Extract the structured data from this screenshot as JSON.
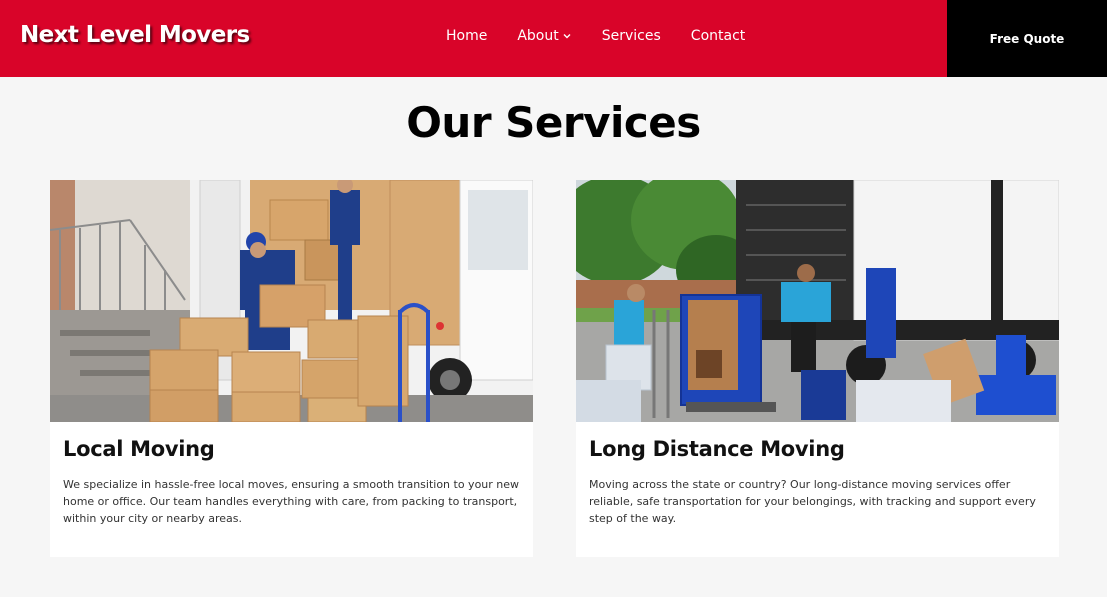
{
  "header": {
    "brand": "Next Level Movers",
    "nav": [
      {
        "label": "Home"
      },
      {
        "label": "About"
      },
      {
        "label": "Services"
      },
      {
        "label": "Contact"
      }
    ],
    "cta": "Free Quote",
    "colors": {
      "header_bg": "#d90429",
      "cta_bg": "#000000"
    }
  },
  "main": {
    "title": "Our Services",
    "cards": [
      {
        "title": "Local Moving",
        "description": "We specialize in hassle-free local moves, ensuring a smooth transition to your new home or office. Our team handles everything with care, from packing to transport, within your city or nearby areas.",
        "image": "movers-unloading-van-photo"
      },
      {
        "title": "Long Distance Moving",
        "description": "Moving across the state or country? Our long-distance moving services offer reliable, safe transportation for your belongings, with tracking and support every step of the way.",
        "image": "movers-loading-truck-photo"
      }
    ]
  }
}
